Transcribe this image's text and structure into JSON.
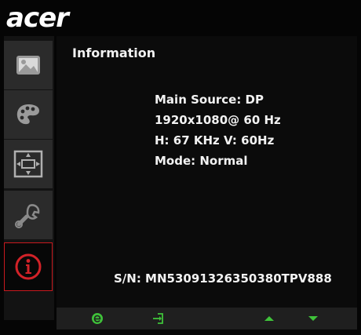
{
  "brand": {
    "logo_text": "acer"
  },
  "sidebar": {
    "items": [
      {
        "icon": "picture-icon",
        "active": false
      },
      {
        "icon": "palette-icon",
        "active": false
      },
      {
        "icon": "position-icon",
        "active": false
      },
      {
        "icon": "wrench-icon",
        "active": false
      },
      {
        "icon": "info-icon",
        "active": true
      }
    ]
  },
  "panel": {
    "title": "Information",
    "lines": [
      "Main Source: DP",
      "1920x1080@ 60 Hz",
      "H: 67 KHz V: 60Hz",
      "Mode: Normal"
    ],
    "serial": "S/N: MN53091326350380TPV888"
  },
  "footer": {
    "buttons": [
      "empowering-e-icon",
      "enter-icon",
      "up-arrow-icon",
      "down-arrow-icon"
    ]
  },
  "colors": {
    "background": "#050505",
    "sidebar_button": "#2b2b2b",
    "active_border": "#c8191e",
    "button_green": "#3fc23a",
    "text": "#f2f2f2"
  }
}
